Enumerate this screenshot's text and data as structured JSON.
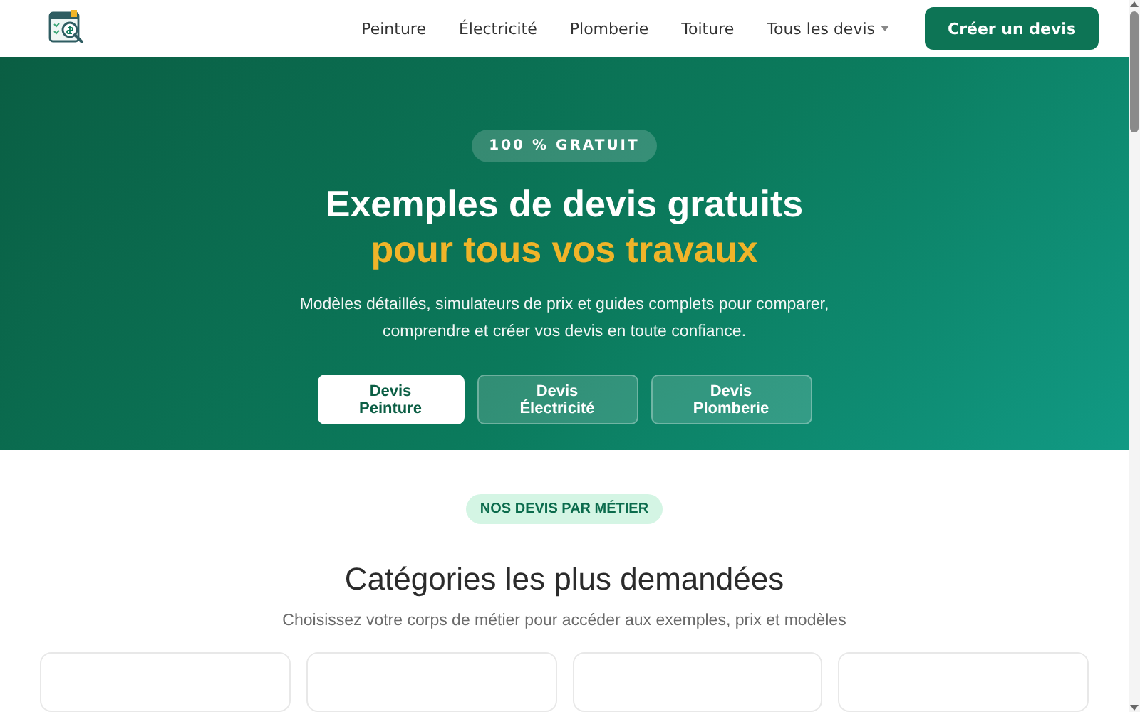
{
  "header": {
    "nav": [
      {
        "label": "Peinture",
        "kind": "link"
      },
      {
        "label": "Électricité",
        "kind": "link"
      },
      {
        "label": "Plomberie",
        "kind": "link"
      },
      {
        "label": "Toiture",
        "kind": "link"
      },
      {
        "label": "Tous les devis",
        "kind": "dropdown"
      }
    ],
    "cta": "Créer un devis"
  },
  "hero": {
    "badge": "100 % GRATUIT",
    "title": "Exemples de devis gratuits",
    "title_highlight": "pour tous vos travaux",
    "subtitle": "Modèles détaillés, simulateurs de prix et guides complets pour comparer, comprendre et créer vos devis en toute confiance.",
    "buttons": [
      {
        "label": "Devis Peinture",
        "kind": "primary"
      },
      {
        "label": "Devis Électricité",
        "kind": "secondary"
      },
      {
        "label": "Devis Plomberie",
        "kind": "secondary"
      }
    ]
  },
  "categories": {
    "badge": "NOS DEVIS PAR MÉTIER",
    "title": "Catégories les plus demandées",
    "subtitle": "Choisissez votre corps de métier pour accéder aux exemples, prix et modèles",
    "cards": [
      {
        "kind": "card"
      },
      {
        "kind": "card"
      },
      {
        "kind": "card"
      },
      {
        "kind": "card"
      }
    ]
  }
}
